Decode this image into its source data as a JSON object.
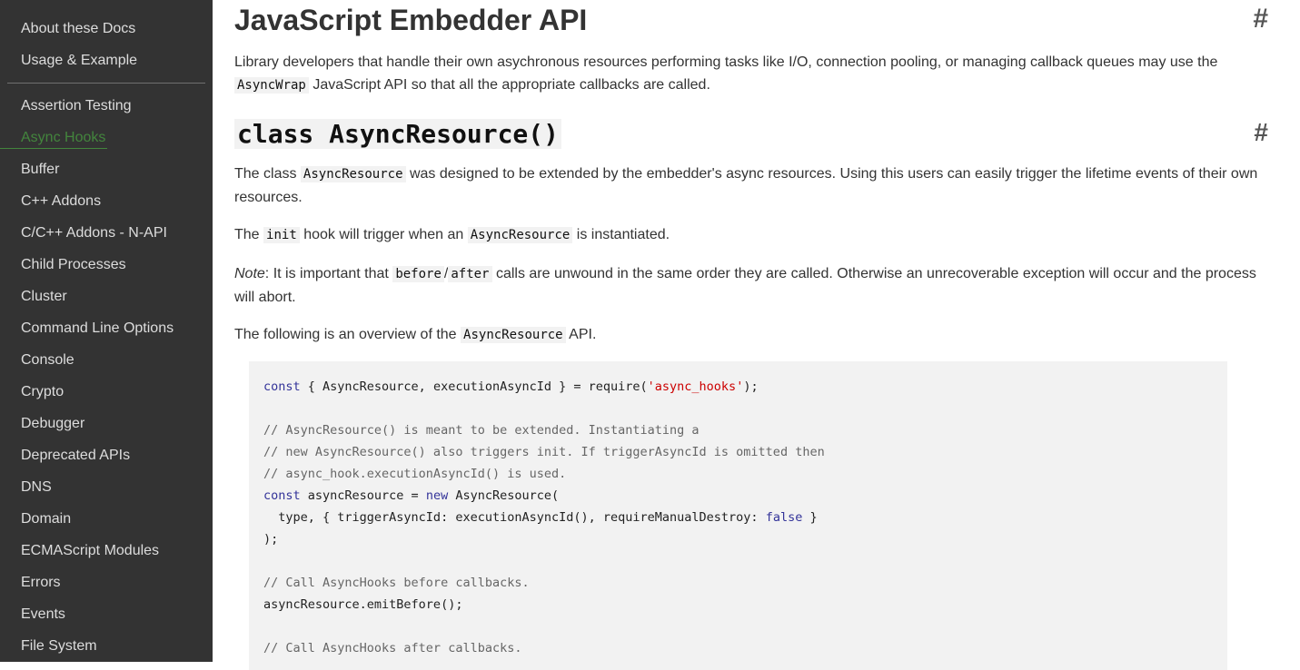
{
  "sidebar": {
    "top_items": [
      "About these Docs",
      "Usage & Example"
    ],
    "items": [
      {
        "label": "Assertion Testing",
        "active": false
      },
      {
        "label": "Async Hooks",
        "active": true
      },
      {
        "label": "Buffer",
        "active": false
      },
      {
        "label": "C++ Addons",
        "active": false
      },
      {
        "label": "C/C++ Addons - N-API",
        "active": false
      },
      {
        "label": "Child Processes",
        "active": false
      },
      {
        "label": "Cluster",
        "active": false
      },
      {
        "label": "Command Line Options",
        "active": false
      },
      {
        "label": "Console",
        "active": false
      },
      {
        "label": "Crypto",
        "active": false
      },
      {
        "label": "Debugger",
        "active": false
      },
      {
        "label": "Deprecated APIs",
        "active": false
      },
      {
        "label": "DNS",
        "active": false
      },
      {
        "label": "Domain",
        "active": false
      },
      {
        "label": "ECMAScript Modules",
        "active": false
      },
      {
        "label": "Errors",
        "active": false
      },
      {
        "label": "Events",
        "active": false
      },
      {
        "label": "File System",
        "active": false
      }
    ],
    "active_color": "#43853d"
  },
  "content": {
    "h1": "JavaScript Embedder API",
    "anchor": "#",
    "intro_text_1": "Library developers that handle their own asychronous resources performing tasks like I/O, connection pooling, or managing callback queues may use the",
    "intro_code": "AsyncWrap",
    "intro_text_2": "JavaScript API so that all the appropriate callbacks are called.",
    "h2": "class AsyncResource()",
    "p1_a": "The class",
    "p1_code": "AsyncResource",
    "p1_b": "was designed to be extended by the embedder's async resources. Using this users can easily trigger the lifetime events of their own resources.",
    "p2_a": "The",
    "p2_code1": "init",
    "p2_b": "hook will trigger when an",
    "p2_code2": "AsyncResource",
    "p2_c": "is instantiated.",
    "p3_note": "Note",
    "p3_a": ": It is important that",
    "p3_code1": "before",
    "p3_slash": "/",
    "p3_code2": "after",
    "p3_b": "calls are unwound in the same order they are called. Otherwise an unrecoverable exception will occur and the process will abort.",
    "p4_a": "The following is an overview of the",
    "p4_code": "AsyncResource",
    "p4_b": "API."
  },
  "code_lines": [
    [
      {
        "t": "const",
        "c": "kw"
      },
      {
        "t": " { AsyncResource, executionAsyncId } = require(",
        "c": ""
      },
      {
        "t": "'async_hooks'",
        "c": "str"
      },
      {
        "t": ");",
        "c": ""
      }
    ],
    [],
    [
      {
        "t": "// AsyncResource() is meant to be extended. Instantiating a",
        "c": "cm"
      }
    ],
    [
      {
        "t": "// new AsyncResource() also triggers init. If triggerAsyncId is omitted then",
        "c": "cm"
      }
    ],
    [
      {
        "t": "// async_hook.executionAsyncId() is used.",
        "c": "cm"
      }
    ],
    [
      {
        "t": "const",
        "c": "kw"
      },
      {
        "t": " asyncResource = ",
        "c": ""
      },
      {
        "t": "new",
        "c": "kw"
      },
      {
        "t": " AsyncResource(",
        "c": ""
      }
    ],
    [
      {
        "t": "  type, { triggerAsyncId: executionAsyncId(), requireManualDestroy: ",
        "c": ""
      },
      {
        "t": "false",
        "c": "kw"
      },
      {
        "t": " }",
        "c": ""
      }
    ],
    [
      {
        "t": ");",
        "c": ""
      }
    ],
    [],
    [
      {
        "t": "// Call AsyncHooks before callbacks.",
        "c": "cm"
      }
    ],
    [
      {
        "t": "asyncResource.emitBefore();",
        "c": ""
      }
    ],
    [],
    [
      {
        "t": "// Call AsyncHooks after callbacks.",
        "c": "cm"
      }
    ]
  ]
}
